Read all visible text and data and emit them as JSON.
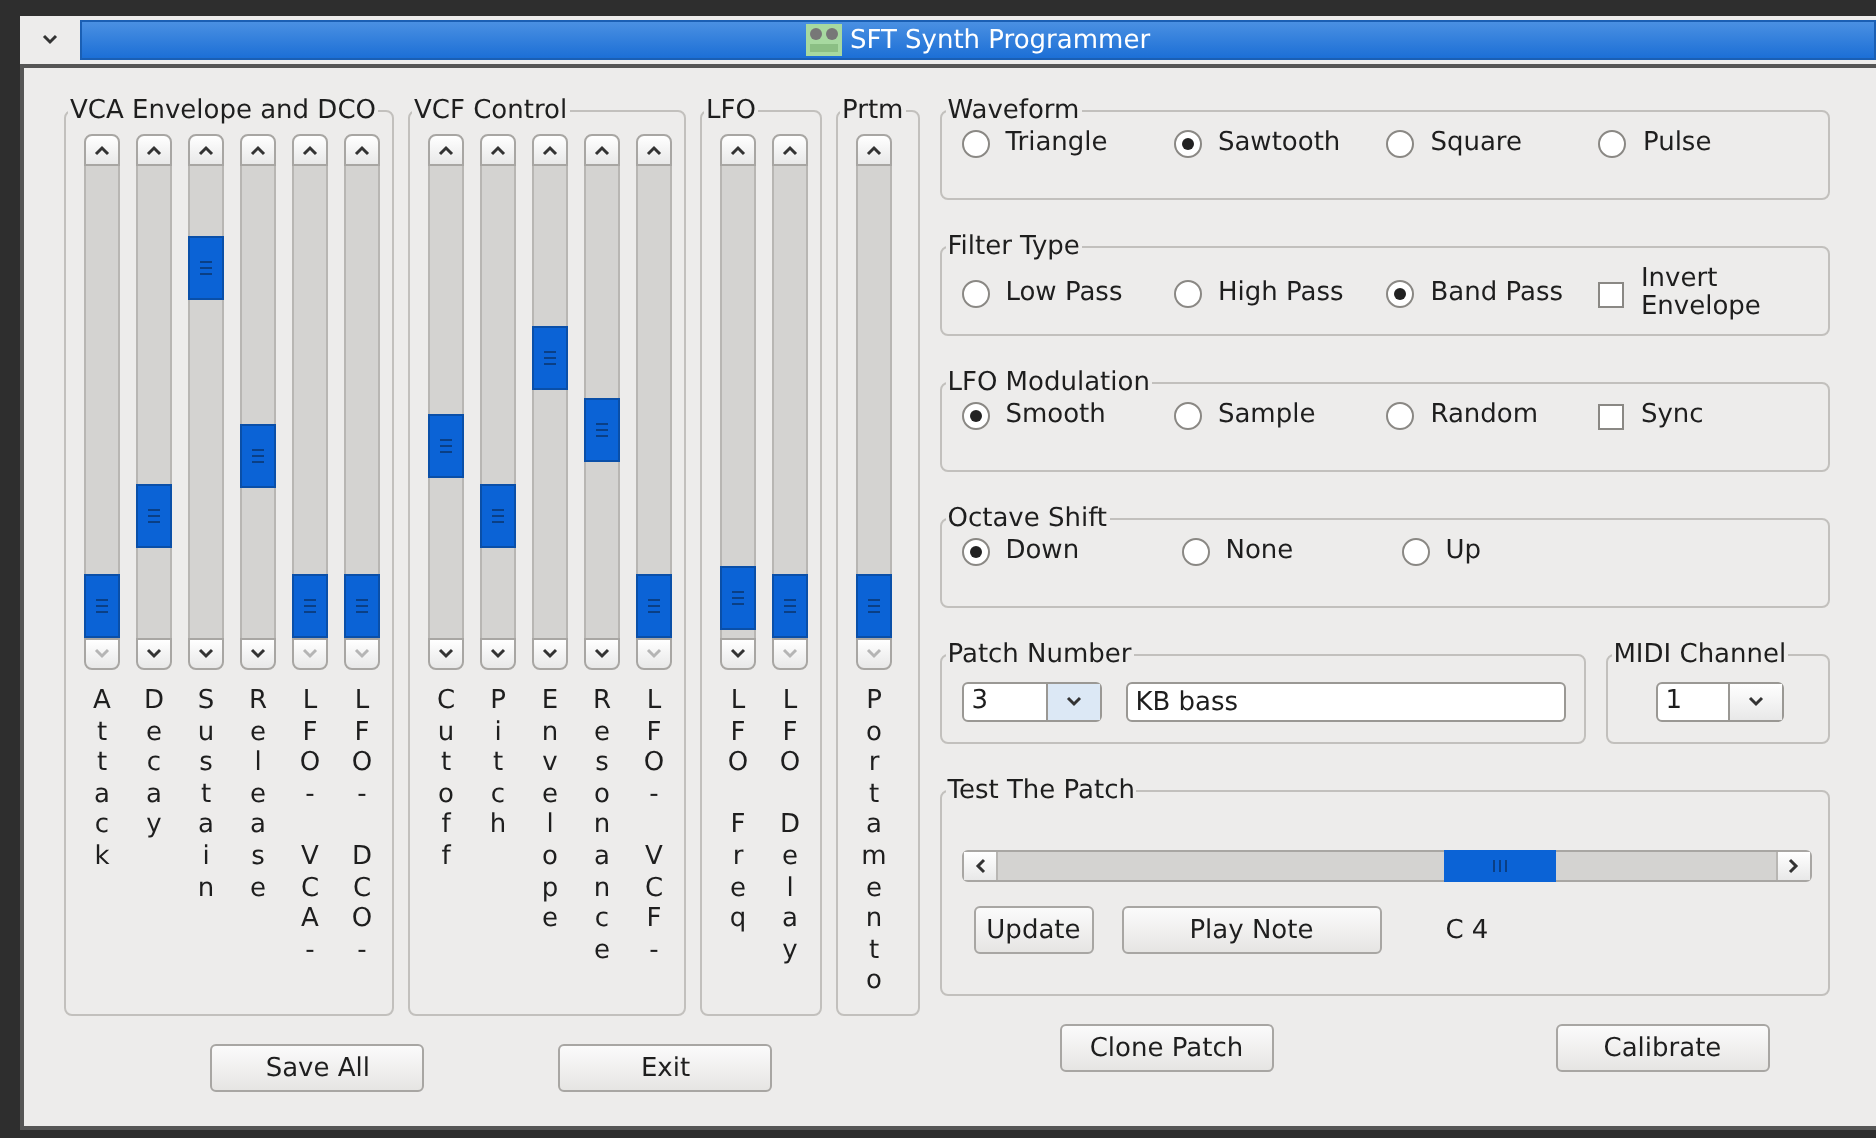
{
  "window": {
    "title": "SFT Synth Programmer"
  },
  "slider_groups": [
    {
      "title": "VCA Envelope and DCO",
      "sliders": [
        {
          "label": "Attack",
          "level": 0
        },
        {
          "label": "Decay",
          "level": 0.22
        },
        {
          "label": "Sustain",
          "level": 0.83
        },
        {
          "label": "Release",
          "level": 0.37
        },
        {
          "label": "LFO- VCA-",
          "level": 0
        },
        {
          "label": "LFO- DCO-",
          "level": 0
        }
      ]
    },
    {
      "title": "VCF Control",
      "sliders": [
        {
          "label": "Cutoff",
          "level": 0.39
        },
        {
          "label": "Pitch",
          "level": 0.22
        },
        {
          "label": "Envelope",
          "level": 0.61
        },
        {
          "label": "Resonance",
          "level": 0.43
        },
        {
          "label": "LFO- VCF-",
          "level": 0
        }
      ]
    },
    {
      "title": "LFO",
      "sliders": [
        {
          "label": "LFO Freq",
          "level": 0.02
        },
        {
          "label": "LFO Delay",
          "level": 0
        }
      ]
    },
    {
      "title": "Prtm",
      "sliders": [
        {
          "label": "Portamento",
          "level": 0
        }
      ]
    }
  ],
  "option_groups": [
    {
      "title": "Waveform",
      "options": [
        {
          "kind": "radio",
          "label": "Triangle",
          "selected": false
        },
        {
          "kind": "radio",
          "label": "Sawtooth",
          "selected": true
        },
        {
          "kind": "radio",
          "label": "Square",
          "selected": false
        },
        {
          "kind": "radio",
          "label": "Pulse",
          "selected": false
        }
      ]
    },
    {
      "title": "Filter Type",
      "options": [
        {
          "kind": "radio",
          "label": "Low Pass",
          "selected": false
        },
        {
          "kind": "radio",
          "label": "High Pass",
          "selected": false
        },
        {
          "kind": "radio",
          "label": "Band Pass",
          "selected": true
        },
        {
          "kind": "checkbox",
          "label": "Invert Envelope",
          "checked": false
        }
      ]
    },
    {
      "title": "LFO Modulation",
      "options": [
        {
          "kind": "radio",
          "label": "Smooth",
          "selected": true
        },
        {
          "kind": "radio",
          "label": "Sample",
          "selected": false
        },
        {
          "kind": "radio",
          "label": "Random",
          "selected": false
        },
        {
          "kind": "checkbox",
          "label": "Sync",
          "checked": false
        }
      ]
    },
    {
      "title": "Octave Shift",
      "options": [
        {
          "kind": "radio",
          "label": "Down",
          "selected": true
        },
        {
          "kind": "radio",
          "label": "None",
          "selected": false
        },
        {
          "kind": "radio",
          "label": "Up",
          "selected": false
        }
      ]
    }
  ],
  "patch_number": {
    "title": "Patch Number",
    "number": "3",
    "name": "KB bass"
  },
  "midi_channel": {
    "title": "MIDI Channel",
    "value": "1"
  },
  "test_patch": {
    "title": "Test The Patch",
    "level": 0.67,
    "buttons": [
      "Update",
      "Play Note"
    ],
    "note": "C 4"
  },
  "buttons": [
    "Save All",
    "Exit",
    "Clone Patch",
    "Calibrate"
  ]
}
